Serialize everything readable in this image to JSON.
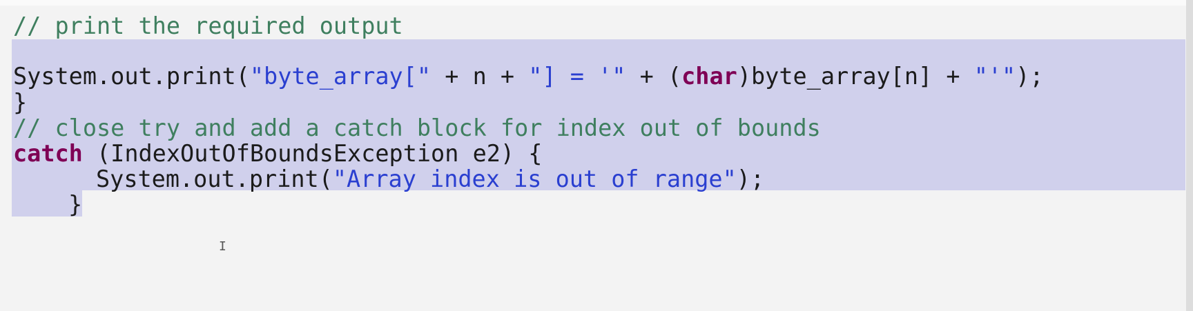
{
  "editor": {
    "lines": {
      "comment_output": "// print the required output",
      "print_prefix": "System.out.print(",
      "str_byte_array_open": "\"byte_array[\"",
      "plus_n_plus": " + n + ",
      "str_close_eq": "\"] = '\"",
      "plus_paren": " + (",
      "kw_char": "char",
      "cast_rest": ")byte_array[n] + ",
      "str_quote": "\"'\"",
      "print_end": ");",
      "close_brace_try": "}",
      "comment_catch": "// close try and add a catch block for index out of bounds",
      "kw_catch": "catch",
      "catch_rest": " (IndexOutOfBoundsException e2) {",
      "print_prefix_2": "System.out.print(",
      "str_range": "\"Array index is out of range\"",
      "print_end_2": ");",
      "close_brace_catch": "}"
    },
    "cursor_glyph": "I"
  }
}
